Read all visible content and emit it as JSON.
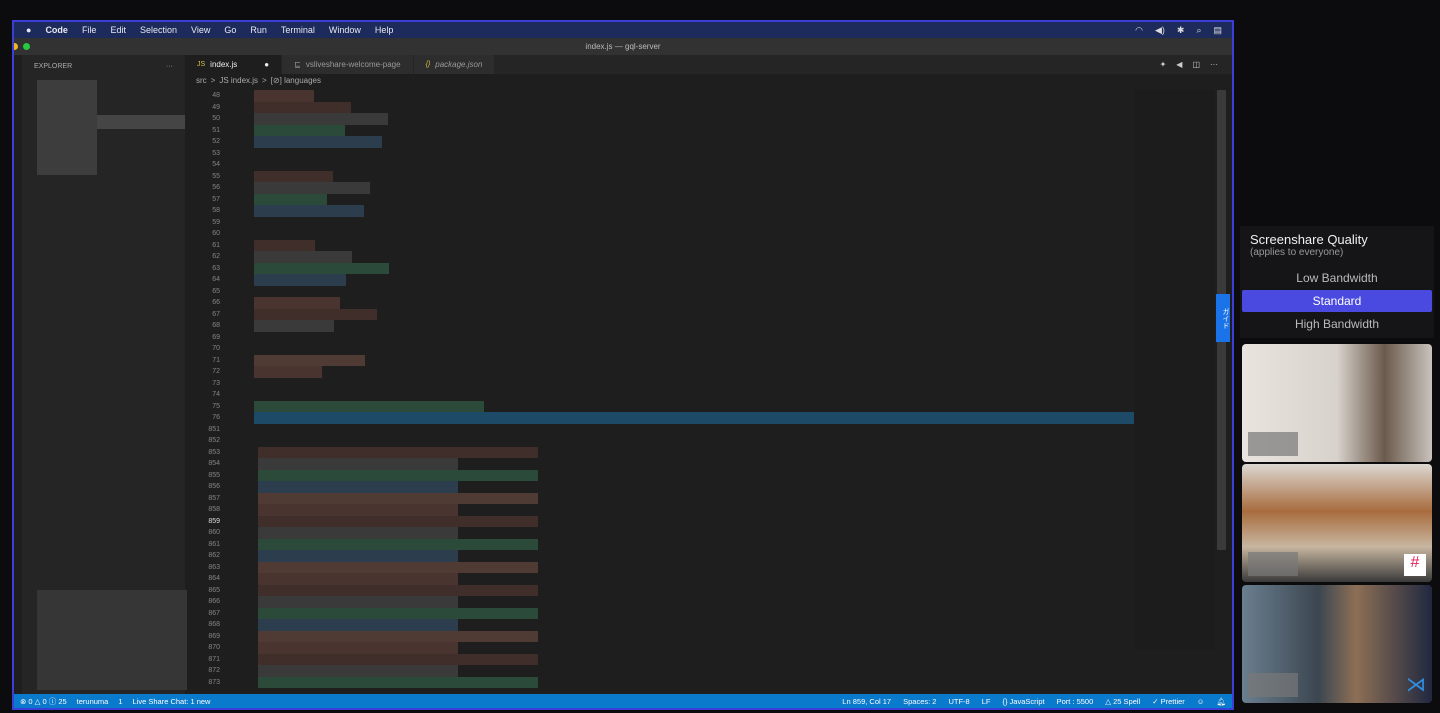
{
  "menubar": {
    "apple": "",
    "items": [
      "Code",
      "File",
      "Edit",
      "Selection",
      "View",
      "Go",
      "Run",
      "Terminal",
      "Window",
      "Help"
    ]
  },
  "window_title": "index.js — gql-server",
  "explorer": {
    "title": "EXPLORER",
    "more": "···"
  },
  "tabs": [
    {
      "icon": "JS",
      "label": "index.js",
      "dirty": "●"
    },
    {
      "icon": "⊑",
      "label": "vsliveshare-welcome-page"
    },
    {
      "icon": "{}",
      "label": "package.json"
    }
  ],
  "breadcrumb": [
    "src",
    ">",
    "JS index.js",
    ">",
    "[⊘] languages"
  ],
  "line_numbers": [
    "48",
    "49",
    "50",
    "51",
    "52",
    "53",
    "54",
    "55",
    "56",
    "57",
    "58",
    "59",
    "60",
    "61",
    "62",
    "63",
    "64",
    "65",
    "66",
    "67",
    "68",
    "69",
    "70",
    "71",
    "72",
    "73",
    "74",
    "75",
    "76",
    "851",
    "852",
    "853",
    "854",
    "855",
    "856",
    "857",
    "858",
    "859",
    "860",
    "861",
    "862",
    "863",
    "864",
    "865",
    "866",
    "867",
    "868",
    "869",
    "870",
    "871",
    "872",
    "873"
  ],
  "current_line": "859",
  "status": {
    "problems": "⊗ 0 △ 0 ⓘ 25",
    "user": "terunuma",
    "shared": "1",
    "chat": "Live Share Chat: 1 new",
    "position": "Ln 859, Col 17",
    "spaces": "Spaces: 2",
    "encoding": "UTF-8",
    "eol": "LF",
    "language": "{} JavaScript",
    "port": "Port : 5500",
    "spell": "△ 25 Spell",
    "prettier": "✓ Prettier"
  },
  "screenshare": {
    "title": "Screenshare Quality",
    "subtitle": "(applies to everyone)",
    "options": [
      "Low Bandwidth",
      "Standard",
      "High Bandwidth"
    ],
    "selected": "Standard"
  },
  "side_tab": "ガイド",
  "colors": {
    "accent": "#4a4ae0",
    "statusbar": "#0a7acc"
  }
}
